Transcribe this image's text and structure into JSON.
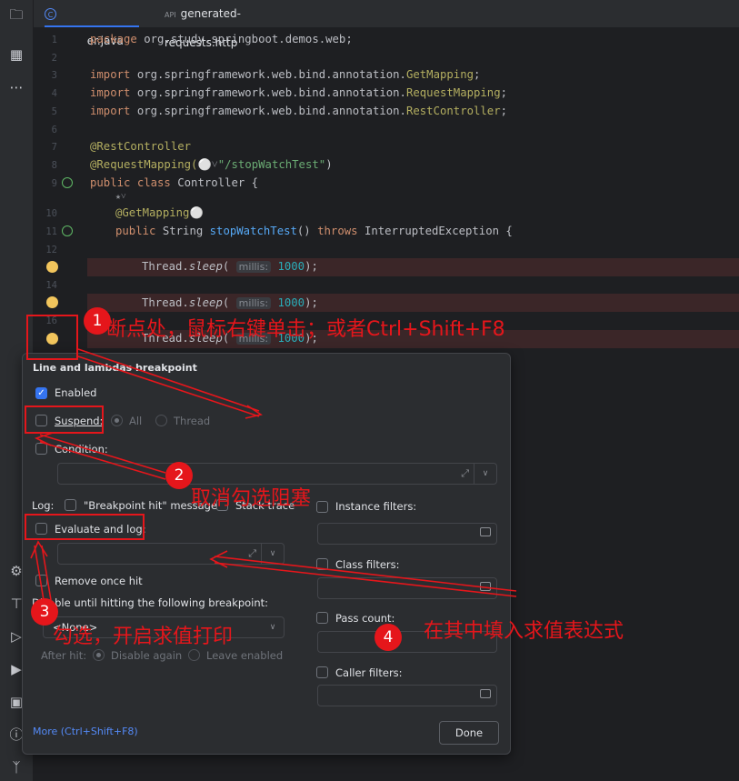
{
  "tabs": [
    {
      "label": "Controller.java",
      "icon": "class-icon",
      "active": true
    },
    {
      "label": "generated-requests.http",
      "icon": "http-file-icon",
      "active": false
    }
  ],
  "code": {
    "lines": [
      {
        "n": "1",
        "text": "package org.study.springboot.demos.web;"
      },
      {
        "n": "2",
        "text": ""
      },
      {
        "n": "3",
        "text": "import org.springframework.web.bind.annotation.GetMapping;"
      },
      {
        "n": "4",
        "text": "import org.springframework.web.bind.annotation.RequestMapping;"
      },
      {
        "n": "5",
        "text": "import org.springframework.web.bind.annotation.RestController;"
      },
      {
        "n": "6",
        "text": ""
      },
      {
        "n": "7",
        "text": "@RestController"
      },
      {
        "n": "8",
        "text": "@RequestMapping("
      },
      {
        "n": "9",
        "text": "public class Controller {"
      },
      {
        "n": "10",
        "text": "@GetMapping"
      },
      {
        "n": "11",
        "text": "public String stopWatchTest() throws InterruptedException {"
      },
      {
        "n": "12",
        "text": ""
      },
      {
        "n": "14",
        "text": ""
      },
      {
        "n": "16",
        "text": ""
      }
    ],
    "request_path": "\"/stopWatchTest\"",
    "sleep_call": "Thread.",
    "sleep_method": "sleep",
    "param_hint": "millis:",
    "param_value": "1000",
    "close": ");"
  },
  "popup": {
    "title": "Line and lambdas breakpoint",
    "enabled_label": "Enabled",
    "suspend_label": "Suspend:",
    "all_label": "All",
    "thread_label": "Thread",
    "condition_label": "Condition:",
    "log_label": "Log:",
    "bp_hit_label": "\"Breakpoint hit\" message",
    "stack_trace_label": "Stack trace",
    "evaluate_label": "Evaluate and log:",
    "remove_label": "Remove once hit",
    "disable_until_label": "Disable until hitting the following breakpoint:",
    "none_option": "<None>",
    "after_hit_label": "After hit:",
    "disable_again_label": "Disable again",
    "leave_enabled_label": "Leave enabled",
    "instance_filters_label": "Instance filters:",
    "class_filters_label": "Class filters:",
    "pass_count_label": "Pass count:",
    "caller_filters_label": "Caller filters:",
    "more_link": "More (Ctrl+Shift+F8)",
    "done_label": "Done"
  },
  "annotations": [
    {
      "num": "1",
      "text": "断点处，鼠标右键单击；或者Ctrl+Shift+F8"
    },
    {
      "num": "2",
      "text": "取消勾选阻塞"
    },
    {
      "num": "3",
      "text": "勾选，开启求值打印"
    },
    {
      "num": "4",
      "text": "在其中填入求值表达式"
    }
  ],
  "colors": {
    "accent": "#3574f0",
    "annotation_red": "#e5161b",
    "breakpoint": "#f2c55c"
  }
}
